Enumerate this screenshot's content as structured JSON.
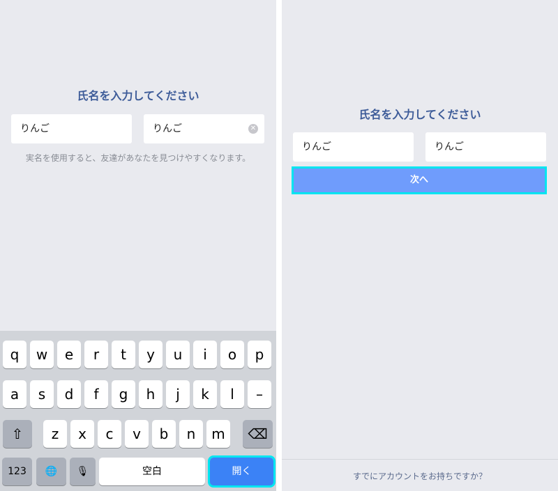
{
  "left": {
    "title": "氏名を入力してください",
    "last_name_value": "りんご",
    "first_name_value": "りんご",
    "hint": "実名を使用すると、友達があなたを見つけやすくなります。"
  },
  "keyboard": {
    "row1": [
      "q",
      "w",
      "e",
      "r",
      "t",
      "y",
      "u",
      "i",
      "o",
      "p"
    ],
    "row2": [
      "a",
      "s",
      "d",
      "f",
      "g",
      "h",
      "j",
      "k",
      "l",
      "–"
    ],
    "row3": [
      "z",
      "x",
      "c",
      "v",
      "b",
      "n",
      "m"
    ],
    "shift_icon": "⇧",
    "backspace_icon": "⌫",
    "numbers_label": "123",
    "globe_icon": "🌐",
    "mic_icon": "🎙",
    "space_label": "空白",
    "open_label": "開く"
  },
  "right": {
    "title": "氏名を入力してください",
    "last_name_value": "りんご",
    "first_name_value": "りんご",
    "next_label": "次へ",
    "footer_link": "すでにアカウントをお持ちですか？"
  },
  "colors": {
    "background": "#e9eaef",
    "title": "#3e5c99",
    "accent": "#3b82f6",
    "highlight": "#00e5f0"
  }
}
